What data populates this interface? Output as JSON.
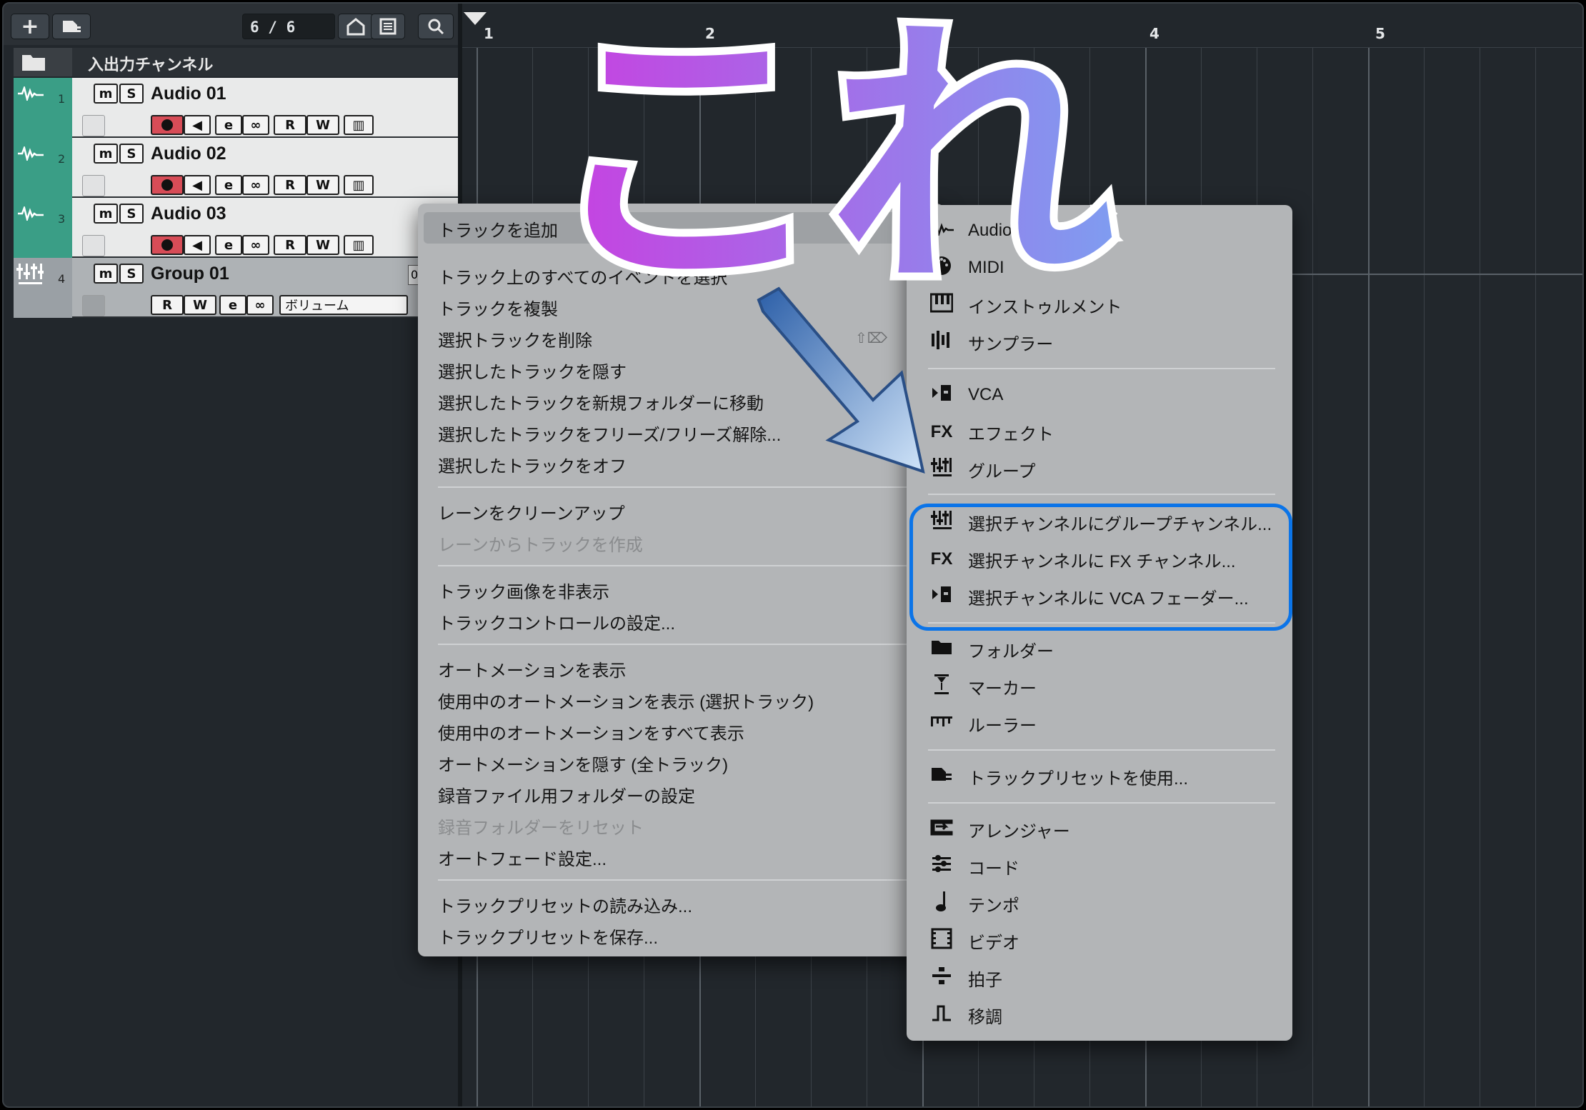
{
  "toolbar": {
    "add_icon": "plus-icon",
    "preset_icon": "track-preset-icon",
    "track_count": "6 / 6",
    "home_icon": "home-icon",
    "list_icon": "list-icon",
    "search_icon": "search-icon"
  },
  "ruler": {
    "bars": [
      "1",
      "2",
      "3",
      "4",
      "5"
    ]
  },
  "tracks": {
    "folder": {
      "name": "入出力チャンネル",
      "icon": "folder-icon"
    },
    "items": [
      {
        "num": "1",
        "name": "Audio 01",
        "type": "audio"
      },
      {
        "num": "2",
        "name": "Audio 02",
        "type": "audio"
      },
      {
        "num": "3",
        "name": "Audio 03",
        "type": "audio"
      },
      {
        "num": "4",
        "name": "Group 01",
        "type": "group",
        "param": "ボリューム",
        "value": "0.0"
      }
    ],
    "buttons": {
      "mute": "m",
      "solo": "S",
      "read": "R",
      "write": "W"
    }
  },
  "menu": {
    "add_track": "トラックを追加",
    "items": [
      "トラック上のすべてのイベントを選択",
      "トラックを複製",
      "選択トラックを削除",
      "選択したトラックを隠す",
      "選択したトラックを新規フォルダーに移動",
      "選択したトラックをフリーズ/フリーズ解除...",
      "選択したトラックをオフ",
      "レーンをクリーンアップ",
      "レーンからトラックを作成",
      "トラック画像を非表示",
      "トラックコントロールの設定...",
      "オートメーションを表示",
      "使用中のオートメーションを表示 (選択トラック)",
      "使用中のオートメーションをすべて表示",
      "オートメーションを隠す (全トラック)",
      "録音ファイル用フォルダーの設定",
      "録音フォルダーをリセット",
      "オートフェード設定...",
      "トラックプリセットの読み込み...",
      "トラックプリセットを保存..."
    ]
  },
  "submenu": {
    "items": [
      {
        "label": "Audio",
        "icon": "waveform-icon"
      },
      {
        "label": "MIDI",
        "icon": "midi-icon"
      },
      {
        "label": "インストゥルメント",
        "icon": "piano-icon"
      },
      {
        "label": "サンプラー",
        "icon": "sampler-icon"
      },
      {
        "label": "VCA",
        "icon": "vca-icon"
      },
      {
        "label": "エフェクト",
        "icon": "fx-icon",
        "glyph": "FX"
      },
      {
        "label": "グループ",
        "icon": "group-icon"
      },
      {
        "label": "選択チャンネルにグループチャンネル...",
        "icon": "group-icon"
      },
      {
        "label": "選択チャンネルに FX チャンネル...",
        "icon": "fx-icon",
        "glyph": "FX"
      },
      {
        "label": "選択チャンネルに VCA フェーダー...",
        "icon": "vca-icon"
      },
      {
        "label": "フォルダー",
        "icon": "folder-icon"
      },
      {
        "label": "マーカー",
        "icon": "marker-icon"
      },
      {
        "label": "ルーラー",
        "icon": "ruler-icon"
      },
      {
        "label": "トラックプリセットを使用...",
        "icon": "track-preset-icon"
      },
      {
        "label": "アレンジャー",
        "icon": "arranger-icon"
      },
      {
        "label": "コード",
        "icon": "chord-icon"
      },
      {
        "label": "テンポ",
        "icon": "tempo-icon"
      },
      {
        "label": "ビデオ",
        "icon": "video-icon"
      },
      {
        "label": "拍子",
        "icon": "signature-icon"
      },
      {
        "label": "移調",
        "icon": "transpose-icon"
      }
    ]
  },
  "annotation": {
    "text": "これ",
    "colors": {
      "start": "#c93ee0",
      "end": "#7f9cf0",
      "highlight": "#0b74e8",
      "arrow": "#3a7dc9"
    }
  }
}
